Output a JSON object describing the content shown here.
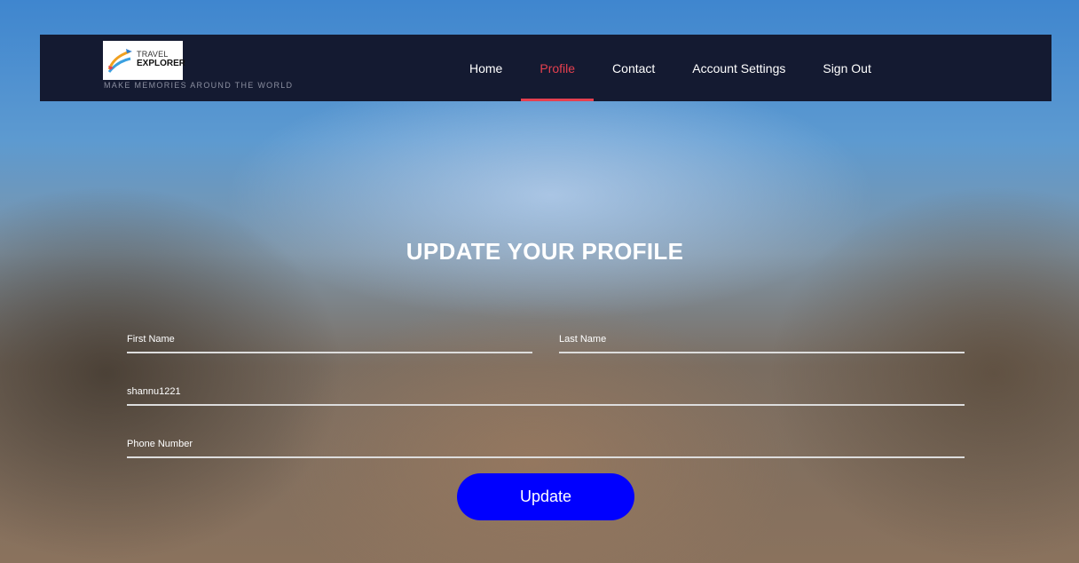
{
  "brand": {
    "logo_line1": "TRAVEL",
    "logo_line2": "EXPLORER",
    "tagline": "MAKE MEMORIES AROUND THE WORLD"
  },
  "nav": {
    "items": [
      {
        "label": "Home",
        "active": false
      },
      {
        "label": "Profile",
        "active": true
      },
      {
        "label": "Contact",
        "active": false
      },
      {
        "label": "Account Settings",
        "active": false
      },
      {
        "label": "Sign Out",
        "active": false
      }
    ],
    "active_color": "#e5404f"
  },
  "page": {
    "title": "UPDATE YOUR PROFILE"
  },
  "form": {
    "first_name_placeholder": "First Name",
    "last_name_placeholder": "Last Name",
    "username_value": "shannu1221",
    "phone_placeholder": "Phone Number",
    "submit_label": "Update",
    "button_color": "#0000ff"
  },
  "colors": {
    "navbar_bg": "#141a31"
  }
}
